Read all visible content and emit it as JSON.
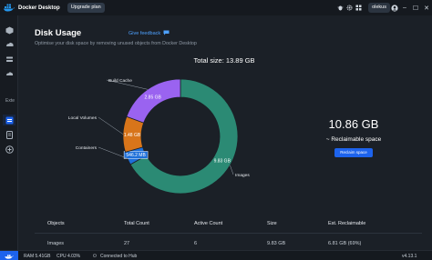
{
  "titlebar": {
    "app_title": "Docker Desktop",
    "upgrade_label": "Upgrade plan",
    "user_label": "olekus",
    "minimize": "–",
    "maximize": "☐",
    "close": "✕"
  },
  "sidebar": {
    "extensions_label": "Exte"
  },
  "page": {
    "title": "Disk Usage",
    "feedback_label": "Give feedback",
    "subtitle": "Optimise your disk space by removing unused objects from Docker Desktop",
    "total_label": "Total size: 13.89 GB",
    "reclaimable_size": "10.86 GB",
    "reclaimable_label": "~ Reclaimable space",
    "reclaim_button": "Reclaim space"
  },
  "chart_data": {
    "type": "pie",
    "variant": "donut",
    "categories": [
      "Images",
      "Containers",
      "Local Volumes",
      "Build Cache"
    ],
    "values": [
      9.83,
      0.5462,
      1.48,
      2.85
    ],
    "value_labels": [
      "9.83 GB",
      "546.2 MB",
      "1.48 GB",
      "2.85 GB"
    ],
    "colors": [
      "#2b8a74",
      "#1d6fd9",
      "#d8751a",
      "#9a63f0"
    ],
    "title": "Total size: 13.89 GB"
  },
  "table": {
    "columns": [
      "Objects",
      "Total Count",
      "Active Count",
      "Size",
      "Est. Reclaimable"
    ],
    "rows": [
      [
        "Images",
        "27",
        "6",
        "9.83 GB",
        "6.81 GB (69%)"
      ]
    ]
  },
  "statusbar": {
    "ram": "RAM 5.41GB",
    "cpu": "CPU 4.03%",
    "hub": "Connected to Hub",
    "version": "v4.13.1"
  }
}
